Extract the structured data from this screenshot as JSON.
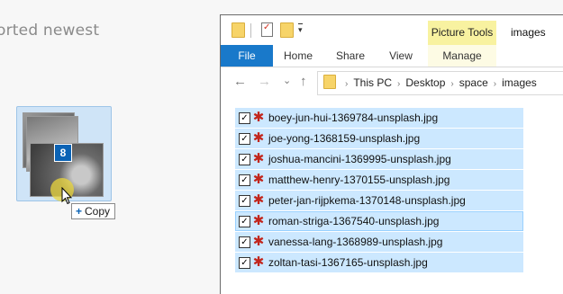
{
  "background_page": {
    "heading_fragment": "orted newest"
  },
  "drag": {
    "count": "8",
    "tooltip_action": "Copy",
    "tooltip_symbol": "+"
  },
  "explorer": {
    "window_title": "images",
    "contextual_tab": "Picture Tools",
    "tabs": [
      "File",
      "Home",
      "Share",
      "View",
      "Manage"
    ],
    "quick_access_dropdown": "▾",
    "nav": {
      "back": "←",
      "forward": "→",
      "recent": "⌄",
      "up": "↑"
    },
    "breadcrumb": [
      "This PC",
      "Desktop",
      "space",
      "images"
    ],
    "breadcrumb_separator": "›",
    "files": [
      {
        "name": "boey-jun-hui-1369784-unsplash.jpg",
        "checked": true
      },
      {
        "name": "joe-yong-1368159-unsplash.jpg",
        "checked": true
      },
      {
        "name": "joshua-mancini-1369995-unsplash.jpg",
        "checked": true
      },
      {
        "name": "matthew-henry-1370155-unsplash.jpg",
        "checked": true
      },
      {
        "name": "peter-jan-rijpkema-1370148-unsplash.jpg",
        "checked": true
      },
      {
        "name": "roman-striga-1367540-unsplash.jpg",
        "checked": true
      },
      {
        "name": "vanessa-lang-1368989-unsplash.jpg",
        "checked": true
      },
      {
        "name": "zoltan-tasi-1367165-unsplash.jpg",
        "checked": true
      }
    ],
    "checkbox_mark": "✓",
    "file_icon": "image-file-icon"
  },
  "colors": {
    "accent": "#1979ca",
    "selection": "#cce8ff",
    "contextual_tab": "#f8f2a0",
    "badge": "#0b63b5",
    "cursor_halo": "#e9d63c"
  }
}
